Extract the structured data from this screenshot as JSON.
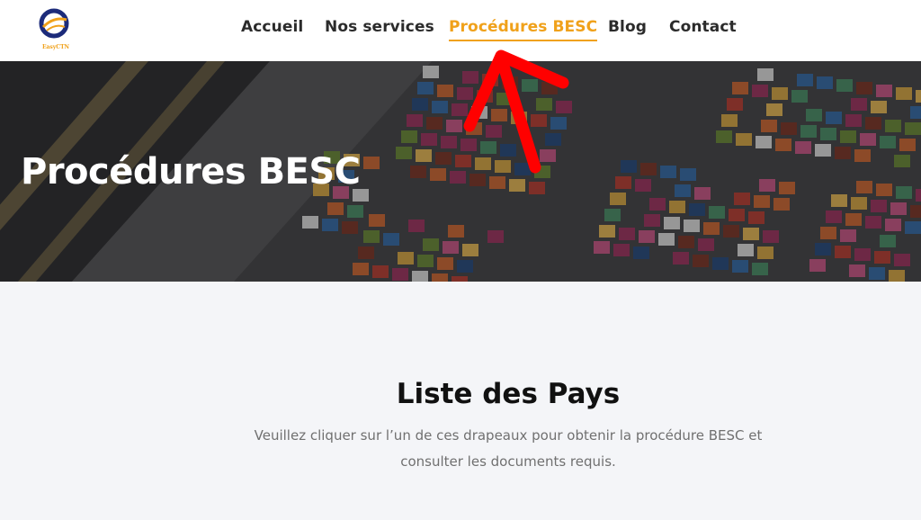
{
  "header": {
    "logo_text": "EasyCTN",
    "nav": [
      {
        "label": "Accueil"
      },
      {
        "label": "Nos services"
      },
      {
        "label": "Procédures BESC"
      },
      {
        "label": "Blog"
      },
      {
        "label": "Contact"
      }
    ],
    "active_index": 2
  },
  "hero": {
    "title": "Procédures BESC",
    "image": "container-port-aerial"
  },
  "section": {
    "title": "Liste des Pays",
    "description": "Veuillez cliquer sur l’un de ces drapeaux pour obtenir la procédure BESC et consulter les documents requis."
  },
  "colors": {
    "accent": "#f0a11a",
    "annotation_arrow": "#ff0000",
    "page_bg": "#f4f5f8"
  }
}
